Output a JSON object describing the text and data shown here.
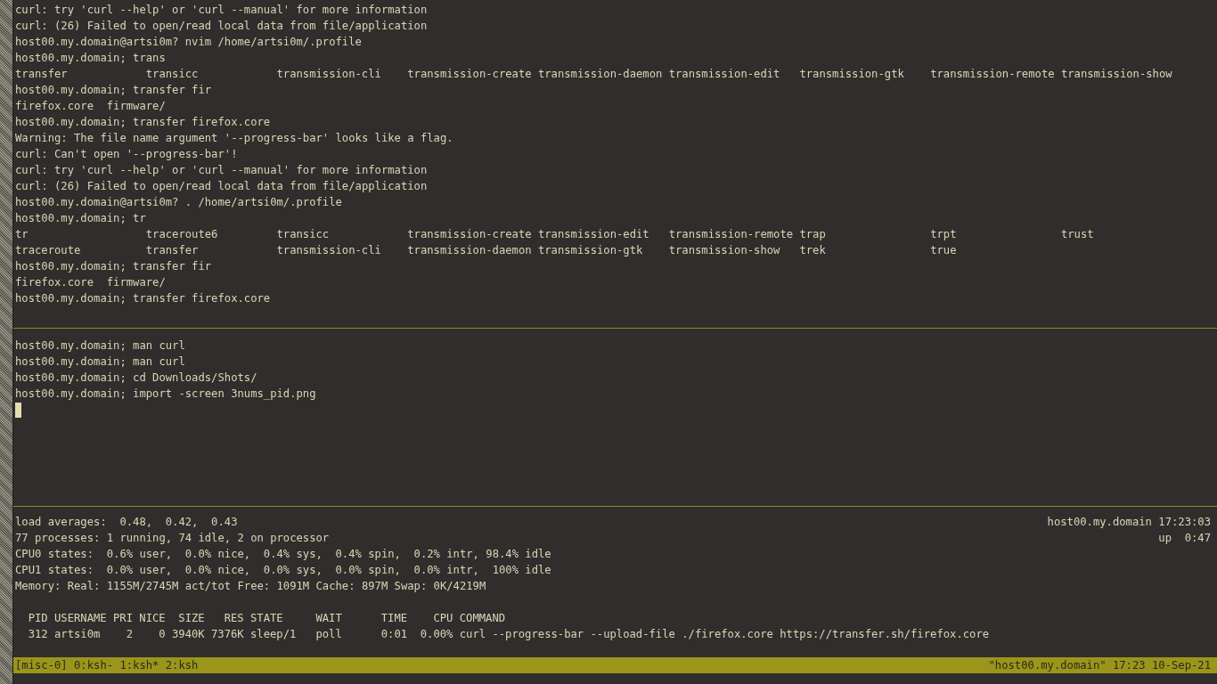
{
  "panes": [
    {
      "kind": "shell",
      "cursor": false,
      "lines": [
        {
          "kind": "text",
          "text": "curl: try 'curl --help' or 'curl --manual' for more information"
        },
        {
          "kind": "text",
          "text": "curl: (26) Failed to open/read local data from file/application"
        },
        {
          "kind": "text",
          "text": "host00.my.domain@artsi0m? nvim /home/artsi0m/.profile"
        },
        {
          "kind": "text",
          "text": "host00.my.domain; trans"
        },
        {
          "kind": "columns",
          "items": [
            "transfer",
            "transicc",
            "transmission-cli",
            "transmission-create",
            "transmission-daemon",
            "transmission-edit",
            "transmission-gtk",
            "transmission-remote",
            "transmission-show"
          ]
        },
        {
          "kind": "text",
          "text": "host00.my.domain; transfer fir"
        },
        {
          "kind": "files",
          "items": [
            "firefox.core",
            "firmware/"
          ]
        },
        {
          "kind": "text",
          "text": "host00.my.domain; transfer firefox.core"
        },
        {
          "kind": "text",
          "text": "Warning: The file name argument '--progress-bar' looks like a flag."
        },
        {
          "kind": "text",
          "text": "curl: Can't open '--progress-bar'!"
        },
        {
          "kind": "text",
          "text": "curl: try 'curl --help' or 'curl --manual' for more information"
        },
        {
          "kind": "text",
          "text": "curl: (26) Failed to open/read local data from file/application"
        },
        {
          "kind": "text",
          "text": "host00.my.domain@artsi0m? . /home/artsi0m/.profile"
        },
        {
          "kind": "text",
          "text": "host00.my.domain; tr"
        },
        {
          "kind": "columns",
          "items": [
            "tr",
            "traceroute6",
            "transicc",
            "transmission-create",
            "transmission-edit",
            "transmission-remote",
            "trap",
            "trpt",
            "trust"
          ]
        },
        {
          "kind": "columns",
          "items": [
            "traceroute",
            "transfer",
            "transmission-cli",
            "transmission-daemon",
            "transmission-gtk",
            "transmission-show",
            "trek",
            "true"
          ]
        },
        {
          "kind": "text",
          "text": "host00.my.domain; transfer fir"
        },
        {
          "kind": "files",
          "items": [
            "firefox.core",
            "firmware/"
          ]
        },
        {
          "kind": "text",
          "text": "host00.my.domain; transfer firefox.core"
        }
      ]
    },
    {
      "kind": "shell",
      "cursor": true,
      "lines": [
        {
          "kind": "text",
          "text": "host00.my.domain; man curl"
        },
        {
          "kind": "text",
          "text": "host00.my.domain; man curl"
        },
        {
          "kind": "text",
          "text": "host00.my.domain; cd Downloads/Shots/"
        },
        {
          "kind": "text",
          "text": "host00.my.domain; import -screen 3nums_pid.png"
        }
      ]
    },
    {
      "kind": "top",
      "summary": [
        {
          "left": "load averages:  0.48,  0.42,  0.43",
          "right": "host00.my.domain 17:23:03"
        },
        {
          "left": "77 processes: 1 running, 74 idle, 2 on processor",
          "right": "up  0:47"
        },
        {
          "left": "CPU0 states:  0.6% user,  0.0% nice,  0.4% sys,  0.4% spin,  0.2% intr, 98.4% idle"
        },
        {
          "left": "CPU1 states:  0.0% user,  0.0% nice,  0.0% sys,  0.0% spin,  0.0% intr,  100% idle"
        },
        {
          "left": "Memory: Real: 1155M/2745M act/tot Free: 1091M Cache: 897M Swap: 0K/4219M"
        }
      ],
      "table": {
        "columns": [
          "PID",
          "USERNAME",
          "PRI",
          "NICE",
          "SIZE",
          "RES",
          "STATE",
          "WAIT",
          "TIME",
          "CPU",
          "COMMAND"
        ],
        "rows": [
          [
            "312",
            "artsi0m",
            "2",
            "0",
            "3940K",
            "7376K",
            "sleep/1",
            "poll",
            "0:01",
            "0.00%",
            "curl --progress-bar --upload-file ./firefox.core https://transfer.sh/firefox.core"
          ]
        ]
      }
    }
  ],
  "status_bar": {
    "session": "[misc-0]",
    "windows": [
      "0:ksh-",
      "1:ksh*",
      "2:ksh"
    ],
    "right": "\"host00.my.domain\" 17:23 10-Sep-21"
  }
}
